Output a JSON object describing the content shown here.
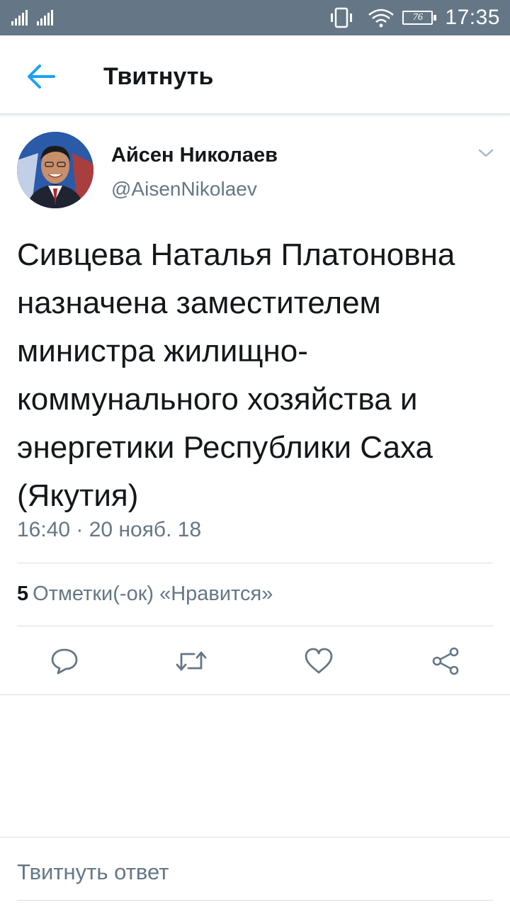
{
  "status_bar": {
    "time": "17:35",
    "battery": "76",
    "icons": [
      "signal-icon",
      "vibrate-icon",
      "wifi-icon",
      "battery-icon"
    ],
    "color": "#657786"
  },
  "app_bar": {
    "title": "Твитнуть",
    "back_icon": "arrow-left-icon"
  },
  "tweet": {
    "author_name": "Айсен Николаев",
    "author_handle": "@AisenNikolaev",
    "text": "Сивцева Наталья Платоновна назначена заместителем министра жилищно-коммунального хозяйства и энергетики Республики Саха (Якутия)",
    "timestamp": "16:40 · 20 нояб. 18",
    "likes_count": "5",
    "likes_label": "Отметки(-ок) «Нравится»",
    "actions": [
      "reply-icon",
      "retweet-icon",
      "like-icon",
      "share-icon"
    ]
  },
  "reply": {
    "placeholder": "Твитнуть ответ"
  },
  "colors": {
    "accent": "#1da1f2",
    "text_primary": "#14171a",
    "text_secondary": "#657786",
    "divider": "#d8dee3"
  }
}
